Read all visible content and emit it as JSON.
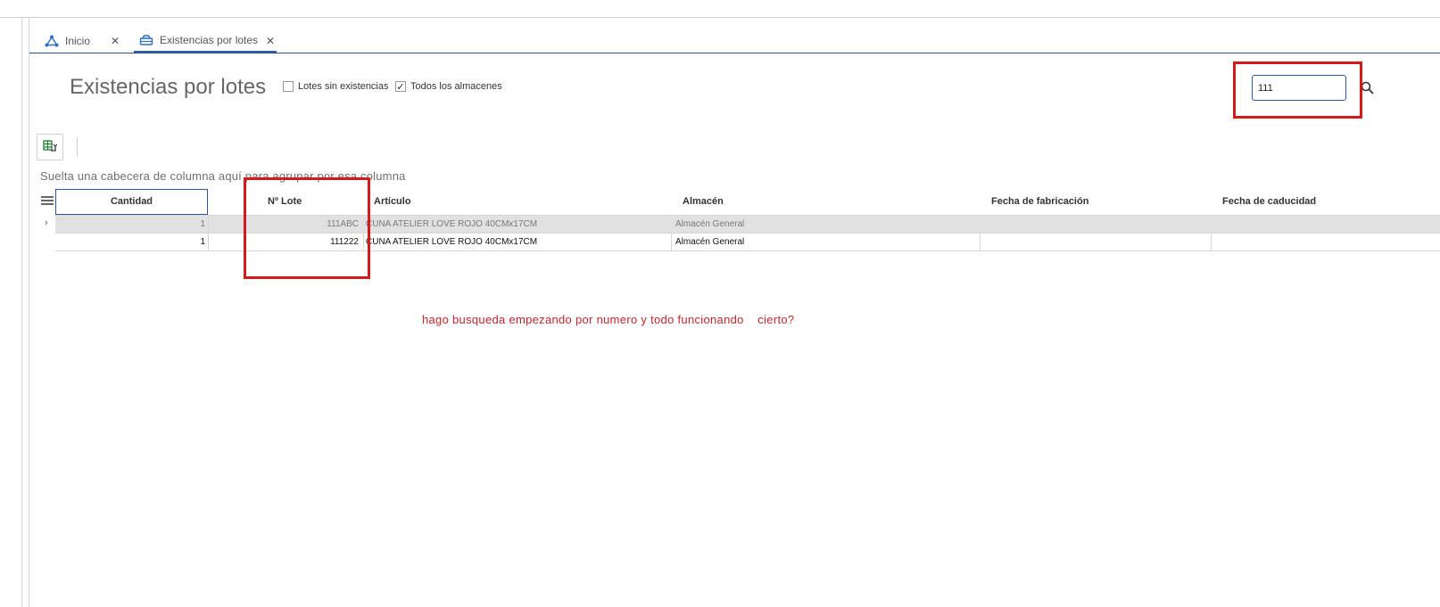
{
  "tabs": [
    {
      "label": "Inicio",
      "icon": "network-icon"
    },
    {
      "label": "Existencias por lotes",
      "icon": "inventory-icon"
    }
  ],
  "page": {
    "title": "Existencias por lotes",
    "filters": [
      {
        "label": "Lotes sin existencias",
        "checked": false
      },
      {
        "label": "Todos los almacenes",
        "checked": true
      }
    ],
    "check_glyph": "✓"
  },
  "search": {
    "value": "111"
  },
  "grid": {
    "group_hint": "Suelta una cabecera de columna aquí para agrupar por esa columna",
    "columns": [
      "Cantidad",
      "Nº Lote",
      "Artículo",
      "Almacén",
      "Fecha de fabricación",
      "Fecha de caducidad"
    ],
    "rows": [
      {
        "cantidad": "1",
        "lote": "111ABC",
        "articulo": "CUNA ATELIER LOVE ROJO 40CMx17CM",
        "almacen": "Almacén General",
        "fabricacion": "",
        "caducidad": "",
        "selected": true
      },
      {
        "cantidad": "1",
        "lote": "111222",
        "articulo": "CUNA ATELIER LOVE ROJO 40CMx17CM",
        "almacen": "Almacén General",
        "fabricacion": "",
        "caducidad": "",
        "selected": false
      }
    ]
  },
  "annotation": {
    "text": "hago busqueda empezando por numero y todo funcionando    cierto?"
  },
  "colors": {
    "accent": "#2f5597",
    "highlight_red": "#d31b1b",
    "annotation_red": "#c1272d",
    "selected_row": "#e1e1e1"
  }
}
